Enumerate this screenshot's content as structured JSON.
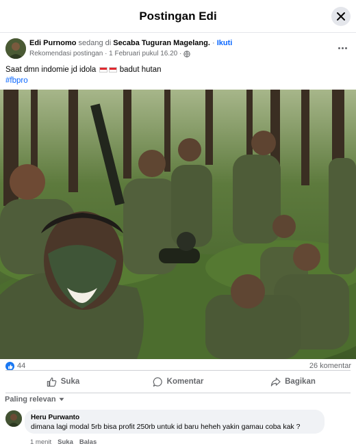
{
  "header": {
    "title": "Postingan Edi"
  },
  "post": {
    "author": "Edi Purnomo",
    "status_prefix": "sedang di",
    "location": "Secaba Tuguran Magelang.",
    "separator": "·",
    "follow_label": "Ikuti",
    "meta": "Rekomendasi postingan · 1 Februari pukul 16.20 ·",
    "caption_part1": "Saat dmn indomie jd idola",
    "caption_part2": "badut hutan",
    "hashtag": "#fbpro",
    "likes": "44",
    "comments": "26 komentar"
  },
  "actions": {
    "like": "Suka",
    "comment": "Komentar",
    "share": "Bagikan"
  },
  "sort_label": "Paling relevan",
  "comment": {
    "author": "Heru Purwanto",
    "text": "dimana lagi modal 5rb bisa profit 250rb untuk id baru heheh yakin gamau coba kak ?",
    "time": "1 menit",
    "like": "Suka",
    "reply": "Balas"
  },
  "colors": {
    "accent": "#0866ff",
    "like_blue": "#1877f2",
    "muted": "#65676b"
  }
}
